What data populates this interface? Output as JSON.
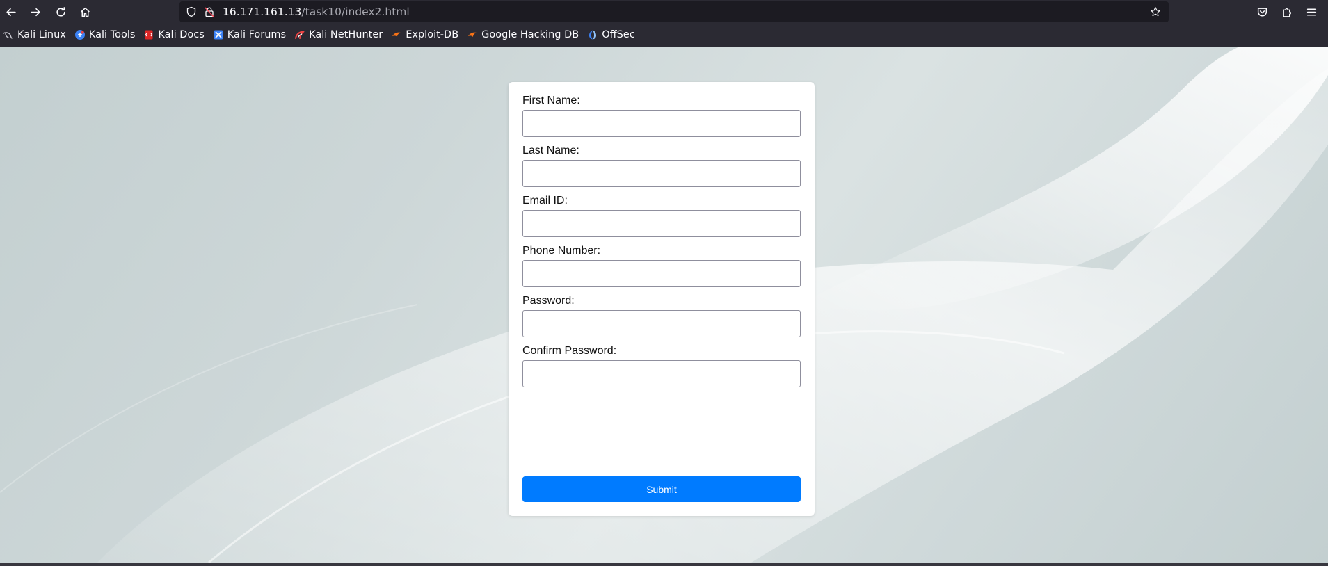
{
  "browser": {
    "url_host": "16.171.161.13",
    "url_path": "/task10/index2.html",
    "bookmarks": [
      {
        "label": "Kali Linux",
        "icon": "kali-dragon-icon"
      },
      {
        "label": "Kali Tools",
        "icon": "kali-tools-icon"
      },
      {
        "label": "Kali Docs",
        "icon": "kali-docs-icon"
      },
      {
        "label": "Kali Forums",
        "icon": "kali-forums-icon"
      },
      {
        "label": "Kali NetHunter",
        "icon": "kali-nethunter-icon"
      },
      {
        "label": "Exploit-DB",
        "icon": "exploit-db-icon"
      },
      {
        "label": "Google Hacking DB",
        "icon": "google-hacking-db-icon"
      },
      {
        "label": "OffSec",
        "icon": "offsec-icon"
      }
    ]
  },
  "form": {
    "fields": [
      {
        "label": "First Name:",
        "value": ""
      },
      {
        "label": "Last Name:",
        "value": ""
      },
      {
        "label": "Email ID:",
        "value": ""
      },
      {
        "label": "Phone Number:",
        "value": ""
      },
      {
        "label": "Password:",
        "value": ""
      },
      {
        "label": "Confirm Password:",
        "value": ""
      }
    ],
    "submit_label": "Submit"
  },
  "colors": {
    "chrome_bg": "#2b2a33",
    "urlbar_bg": "#1c1b22",
    "submit_button": "#007bff",
    "page_bg": "#cdd7d8"
  }
}
